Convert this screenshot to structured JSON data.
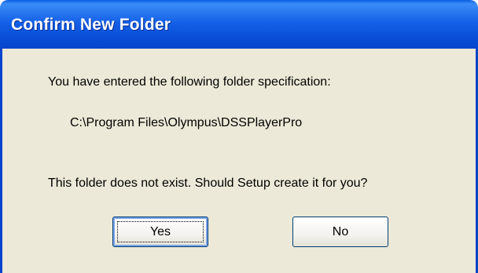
{
  "window": {
    "title": "Confirm New Folder"
  },
  "message": {
    "intro": "You have entered the following folder specification:",
    "path": "C:\\Program Files\\Olympus\\DSSPlayerPro",
    "question": "This folder does not exist.  Should Setup create it for you?"
  },
  "buttons": {
    "yes_label": "Yes",
    "no_label": "No"
  },
  "colors": {
    "titlebar": "#0a4fd8",
    "dialog_background": "#ece9d8",
    "button_border": "#003c74"
  }
}
